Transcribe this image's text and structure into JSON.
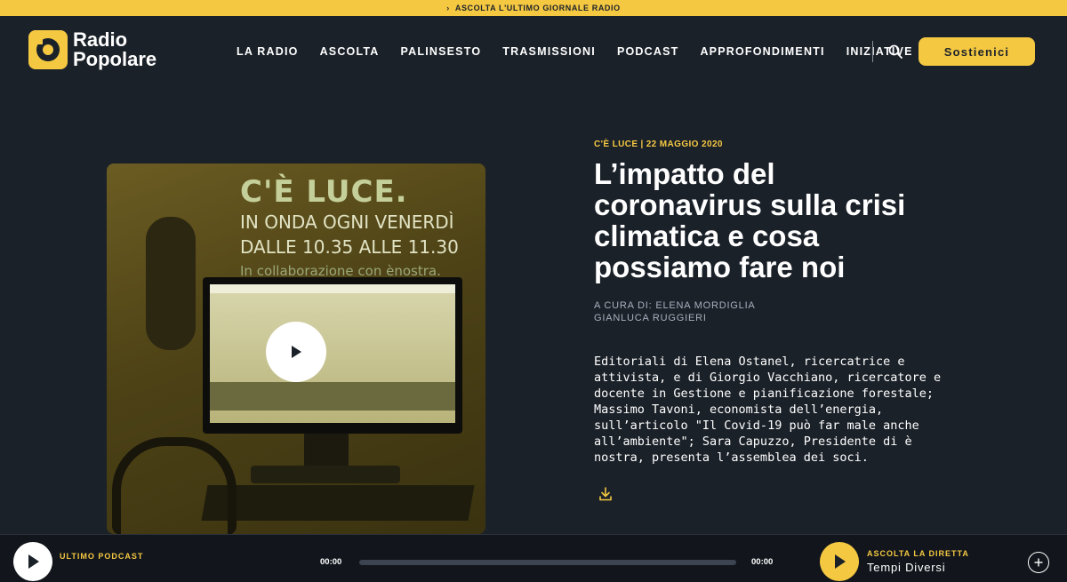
{
  "topbar": {
    "label": "ASCOLTA L'ULTIMO GIORNALE RADIO"
  },
  "logo": {
    "line1": "Radio",
    "line2": "Popolare"
  },
  "nav": {
    "items": [
      "LA RADIO",
      "ASCOLTA",
      "PALINSESTO",
      "TRASMISSIONI",
      "PODCAST",
      "APPROFONDIMENTI",
      "INIZIATIVE"
    ],
    "support_label": "Sostienici"
  },
  "hero": {
    "promo_line1": "C'È LUCE.",
    "promo_line2": "IN ONDA OGNI VENERDÌ",
    "promo_line3": "DALLE 10.35 ALLE 11.30",
    "promo_line4": "In collaborazione con ènostra."
  },
  "article": {
    "category": "C'È LUCE",
    "separator": "|",
    "date": "22 MAGGIO 2020",
    "title": "L’impatto del coronavirus sulla crisi climatica e cosa possiamo fare noi",
    "authors_line1": "A CURA DI: ELENA MORDIGLIA",
    "authors_line2": "GIANLUCA RUGGIERI",
    "description": "Editoriali di Elena Ostanel, ricercatrice e attivista, e di Giorgio Vacchiano, ricercatore e docente in Gestione e pianificazione forestale; Massimo Tavoni, economista dell’energia, sull’articolo \"Il Covid-19 può far male anche all’ambiente\"; Sara Capuzzo, Presidente di è nostra, presenta l’assemblea dei soci."
  },
  "player": {
    "last_podcast_label": "ULTIMO PODCAST",
    "time_start": "00:00",
    "time_end": "00:00",
    "progress": 0,
    "live_label": "ASCOLTA LA DIRETTA",
    "show_name": "Tempi Diversi"
  },
  "colors": {
    "accent": "#f5c842",
    "background": "#1b2129",
    "player_bg": "#12161c"
  }
}
